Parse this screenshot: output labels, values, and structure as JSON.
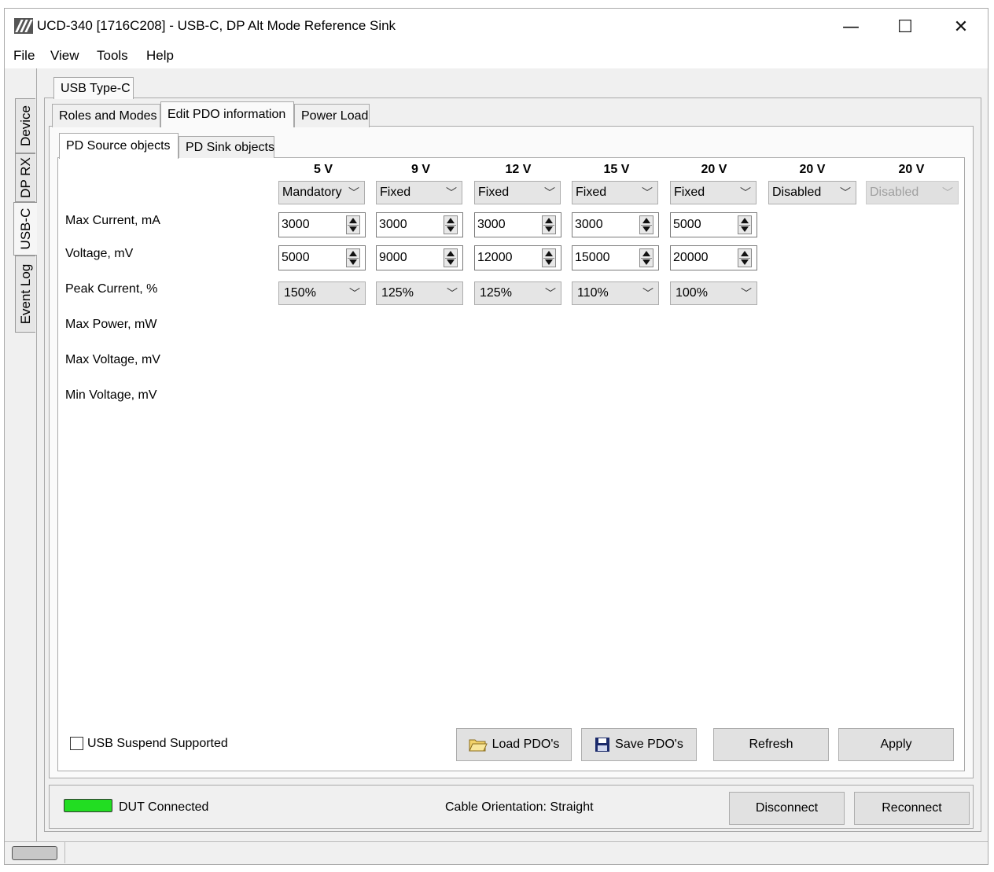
{
  "window": {
    "title": "UCD-340 [1716C208] - USB-C, DP Alt Mode Reference Sink",
    "minimize": "—",
    "maximize": "☐",
    "close": "✕"
  },
  "menu": [
    "File",
    "View",
    "Tools",
    "Help"
  ],
  "side_tabs": [
    "Device",
    "DP RX",
    "USB-C",
    "Event Log"
  ],
  "top_tab": "USB Type-C",
  "sub_tabs": [
    "Roles and Modes",
    "Edit PDO information",
    "Power Load"
  ],
  "pdo_tabs": [
    "PD Source objects",
    "PD Sink objects"
  ],
  "columns": [
    "5 V",
    "9 V",
    "12 V",
    "15 V",
    "20 V",
    "20 V",
    "20 V"
  ],
  "pdo_types": [
    "Mandatory",
    "Fixed",
    "Fixed",
    "Fixed",
    "Fixed",
    "Disabled",
    "Disabled"
  ],
  "row_labels": [
    "Max Current, mA",
    "Voltage, mV",
    "Peak Current, %",
    "Max Power, mW",
    "Max Voltage, mV",
    "Min Voltage, mV"
  ],
  "max_current": [
    "3000",
    "3000",
    "3000",
    "3000",
    "5000"
  ],
  "voltage": [
    "5000",
    "9000",
    "12000",
    "15000",
    "20000"
  ],
  "peak_current": [
    "150%",
    "125%",
    "125%",
    "110%",
    "100%"
  ],
  "usb_suspend_label": "USB Suspend Supported",
  "buttons": {
    "load": "Load PDO's",
    "save": "Save PDO's",
    "refresh": "Refresh",
    "apply": "Apply",
    "disconnect": "Disconnect",
    "reconnect": "Reconnect"
  },
  "status": {
    "dut": "DUT Connected",
    "dut_color": "#22dd22",
    "cable": "Cable Orientation: Straight"
  }
}
